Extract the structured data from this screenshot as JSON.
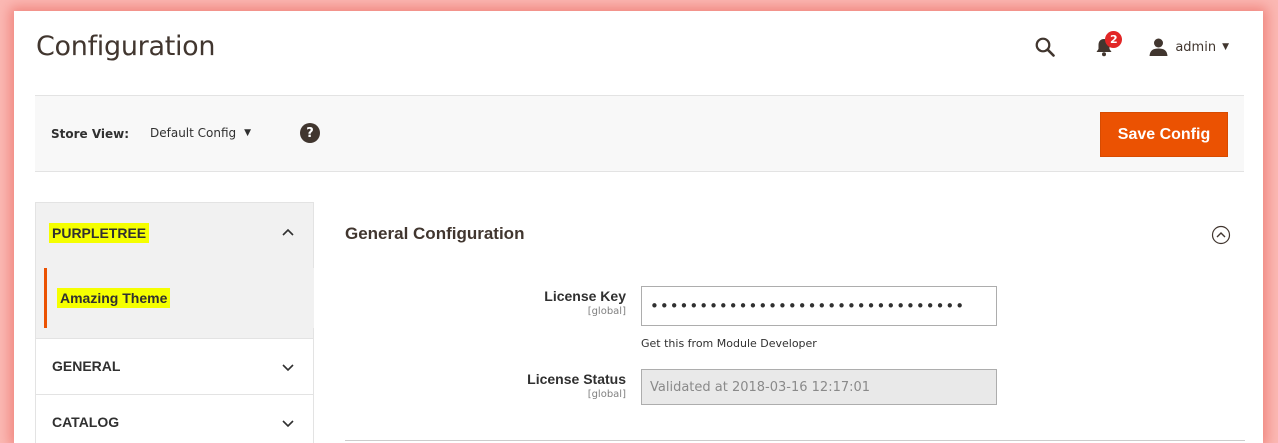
{
  "header": {
    "title": "Configuration",
    "notification_count": "2",
    "user_name": "admin"
  },
  "store_bar": {
    "label": "Store View:",
    "selected": "Default Config",
    "save_label": "Save Config"
  },
  "sidebar": {
    "sections": [
      {
        "title": "PURPLETREE",
        "expanded": true,
        "items": [
          {
            "label": "Amazing Theme",
            "active": true
          }
        ]
      },
      {
        "title": "GENERAL",
        "expanded": false
      },
      {
        "title": "CATALOG",
        "expanded": false
      }
    ]
  },
  "main": {
    "section_title": "General Configuration",
    "fields": [
      {
        "label": "License Key",
        "scope": "[global]",
        "value": "••••••••••••••••••••••••••••••••",
        "note": "Get this from Module Developer"
      },
      {
        "label": "License Status",
        "scope": "[global]",
        "value": "Validated at 2018-03-16 12:17:01"
      }
    ]
  },
  "colors": {
    "accent": "#eb5202",
    "highlight": "#f5ff00",
    "frame_glow": "#fbb9b4"
  },
  "icons": [
    "search-icon",
    "bell-icon",
    "user-icon",
    "caret-down-icon",
    "help-icon",
    "chevron-up-icon",
    "chevron-down-icon",
    "collapse-circle-icon"
  ]
}
